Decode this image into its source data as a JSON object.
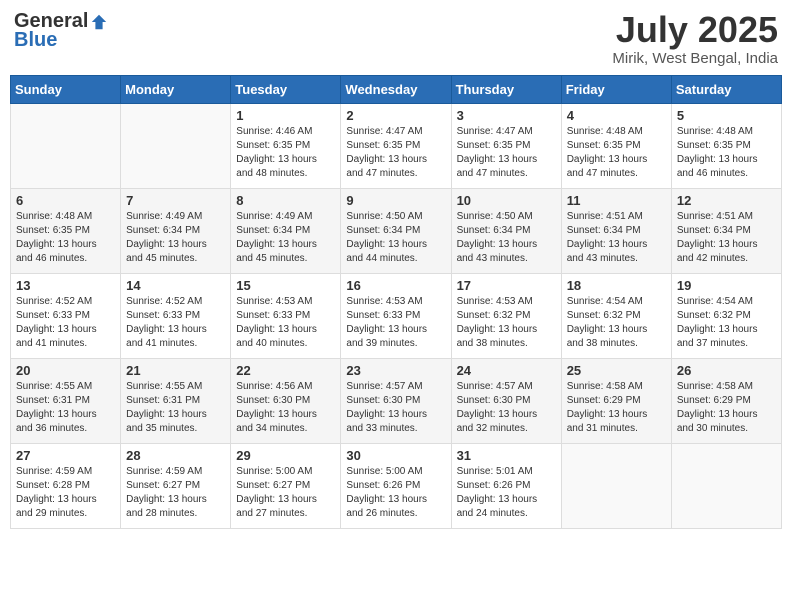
{
  "header": {
    "logo_general": "General",
    "logo_blue": "Blue",
    "month_title": "July 2025",
    "location": "Mirik, West Bengal, India"
  },
  "days_of_week": [
    "Sunday",
    "Monday",
    "Tuesday",
    "Wednesday",
    "Thursday",
    "Friday",
    "Saturday"
  ],
  "weeks": [
    [
      {
        "day": "",
        "sunrise": "",
        "sunset": "",
        "daylight": ""
      },
      {
        "day": "",
        "sunrise": "",
        "sunset": "",
        "daylight": ""
      },
      {
        "day": "1",
        "sunrise": "Sunrise: 4:46 AM",
        "sunset": "Sunset: 6:35 PM",
        "daylight": "Daylight: 13 hours and 48 minutes."
      },
      {
        "day": "2",
        "sunrise": "Sunrise: 4:47 AM",
        "sunset": "Sunset: 6:35 PM",
        "daylight": "Daylight: 13 hours and 47 minutes."
      },
      {
        "day": "3",
        "sunrise": "Sunrise: 4:47 AM",
        "sunset": "Sunset: 6:35 PM",
        "daylight": "Daylight: 13 hours and 47 minutes."
      },
      {
        "day": "4",
        "sunrise": "Sunrise: 4:48 AM",
        "sunset": "Sunset: 6:35 PM",
        "daylight": "Daylight: 13 hours and 47 minutes."
      },
      {
        "day": "5",
        "sunrise": "Sunrise: 4:48 AM",
        "sunset": "Sunset: 6:35 PM",
        "daylight": "Daylight: 13 hours and 46 minutes."
      }
    ],
    [
      {
        "day": "6",
        "sunrise": "Sunrise: 4:48 AM",
        "sunset": "Sunset: 6:35 PM",
        "daylight": "Daylight: 13 hours and 46 minutes."
      },
      {
        "day": "7",
        "sunrise": "Sunrise: 4:49 AM",
        "sunset": "Sunset: 6:34 PM",
        "daylight": "Daylight: 13 hours and 45 minutes."
      },
      {
        "day": "8",
        "sunrise": "Sunrise: 4:49 AM",
        "sunset": "Sunset: 6:34 PM",
        "daylight": "Daylight: 13 hours and 45 minutes."
      },
      {
        "day": "9",
        "sunrise": "Sunrise: 4:50 AM",
        "sunset": "Sunset: 6:34 PM",
        "daylight": "Daylight: 13 hours and 44 minutes."
      },
      {
        "day": "10",
        "sunrise": "Sunrise: 4:50 AM",
        "sunset": "Sunset: 6:34 PM",
        "daylight": "Daylight: 13 hours and 43 minutes."
      },
      {
        "day": "11",
        "sunrise": "Sunrise: 4:51 AM",
        "sunset": "Sunset: 6:34 PM",
        "daylight": "Daylight: 13 hours and 43 minutes."
      },
      {
        "day": "12",
        "sunrise": "Sunrise: 4:51 AM",
        "sunset": "Sunset: 6:34 PM",
        "daylight": "Daylight: 13 hours and 42 minutes."
      }
    ],
    [
      {
        "day": "13",
        "sunrise": "Sunrise: 4:52 AM",
        "sunset": "Sunset: 6:33 PM",
        "daylight": "Daylight: 13 hours and 41 minutes."
      },
      {
        "day": "14",
        "sunrise": "Sunrise: 4:52 AM",
        "sunset": "Sunset: 6:33 PM",
        "daylight": "Daylight: 13 hours and 41 minutes."
      },
      {
        "day": "15",
        "sunrise": "Sunrise: 4:53 AM",
        "sunset": "Sunset: 6:33 PM",
        "daylight": "Daylight: 13 hours and 40 minutes."
      },
      {
        "day": "16",
        "sunrise": "Sunrise: 4:53 AM",
        "sunset": "Sunset: 6:33 PM",
        "daylight": "Daylight: 13 hours and 39 minutes."
      },
      {
        "day": "17",
        "sunrise": "Sunrise: 4:53 AM",
        "sunset": "Sunset: 6:32 PM",
        "daylight": "Daylight: 13 hours and 38 minutes."
      },
      {
        "day": "18",
        "sunrise": "Sunrise: 4:54 AM",
        "sunset": "Sunset: 6:32 PM",
        "daylight": "Daylight: 13 hours and 38 minutes."
      },
      {
        "day": "19",
        "sunrise": "Sunrise: 4:54 AM",
        "sunset": "Sunset: 6:32 PM",
        "daylight": "Daylight: 13 hours and 37 minutes."
      }
    ],
    [
      {
        "day": "20",
        "sunrise": "Sunrise: 4:55 AM",
        "sunset": "Sunset: 6:31 PM",
        "daylight": "Daylight: 13 hours and 36 minutes."
      },
      {
        "day": "21",
        "sunrise": "Sunrise: 4:55 AM",
        "sunset": "Sunset: 6:31 PM",
        "daylight": "Daylight: 13 hours and 35 minutes."
      },
      {
        "day": "22",
        "sunrise": "Sunrise: 4:56 AM",
        "sunset": "Sunset: 6:30 PM",
        "daylight": "Daylight: 13 hours and 34 minutes."
      },
      {
        "day": "23",
        "sunrise": "Sunrise: 4:57 AM",
        "sunset": "Sunset: 6:30 PM",
        "daylight": "Daylight: 13 hours and 33 minutes."
      },
      {
        "day": "24",
        "sunrise": "Sunrise: 4:57 AM",
        "sunset": "Sunset: 6:30 PM",
        "daylight": "Daylight: 13 hours and 32 minutes."
      },
      {
        "day": "25",
        "sunrise": "Sunrise: 4:58 AM",
        "sunset": "Sunset: 6:29 PM",
        "daylight": "Daylight: 13 hours and 31 minutes."
      },
      {
        "day": "26",
        "sunrise": "Sunrise: 4:58 AM",
        "sunset": "Sunset: 6:29 PM",
        "daylight": "Daylight: 13 hours and 30 minutes."
      }
    ],
    [
      {
        "day": "27",
        "sunrise": "Sunrise: 4:59 AM",
        "sunset": "Sunset: 6:28 PM",
        "daylight": "Daylight: 13 hours and 29 minutes."
      },
      {
        "day": "28",
        "sunrise": "Sunrise: 4:59 AM",
        "sunset": "Sunset: 6:27 PM",
        "daylight": "Daylight: 13 hours and 28 minutes."
      },
      {
        "day": "29",
        "sunrise": "Sunrise: 5:00 AM",
        "sunset": "Sunset: 6:27 PM",
        "daylight": "Daylight: 13 hours and 27 minutes."
      },
      {
        "day": "30",
        "sunrise": "Sunrise: 5:00 AM",
        "sunset": "Sunset: 6:26 PM",
        "daylight": "Daylight: 13 hours and 26 minutes."
      },
      {
        "day": "31",
        "sunrise": "Sunrise: 5:01 AM",
        "sunset": "Sunset: 6:26 PM",
        "daylight": "Daylight: 13 hours and 24 minutes."
      },
      {
        "day": "",
        "sunrise": "",
        "sunset": "",
        "daylight": ""
      },
      {
        "day": "",
        "sunrise": "",
        "sunset": "",
        "daylight": ""
      }
    ]
  ]
}
